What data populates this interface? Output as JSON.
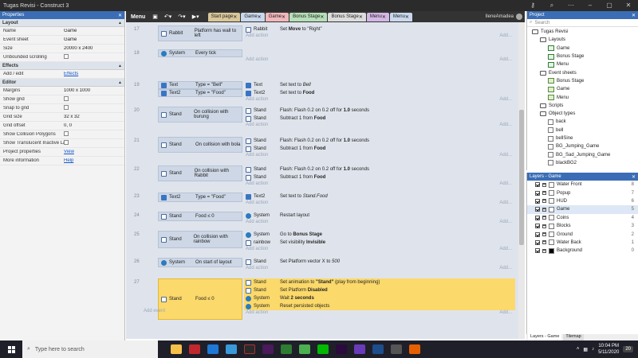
{
  "app": {
    "title": "Tugas Revisi - Construct 3"
  },
  "properties": {
    "header": "Properties",
    "sections": [
      {
        "name": "Layout",
        "rows": [
          {
            "k": "Name",
            "v": "Game"
          },
          {
            "k": "Event sheet",
            "v": "Game"
          },
          {
            "k": "Size",
            "v": "20000 x 2400"
          },
          {
            "k": "Unbounded scrolling",
            "v": ""
          }
        ]
      },
      {
        "name": "Effects",
        "rows": [
          {
            "k": "Add / edit",
            "v": "Effects",
            "link": true
          }
        ]
      },
      {
        "name": "Editor",
        "rows": [
          {
            "k": "Margins",
            "v": "1000 x 1000"
          },
          {
            "k": "Show grid",
            "v": ""
          },
          {
            "k": "Snap to grid",
            "v": ""
          },
          {
            "k": "Grid size",
            "v": "32 x 32"
          },
          {
            "k": "Grid offset",
            "v": "0, 0"
          },
          {
            "k": "Show Collision Polygons",
            "v": ""
          },
          {
            "k": "Show Translucent Inactive Layers",
            "v": ""
          },
          {
            "k": "Project properties",
            "v": "View",
            "link": true
          },
          {
            "k": "More information",
            "v": "Help",
            "link": true
          }
        ]
      }
    ]
  },
  "toolbar": {
    "menu": "Menu",
    "user": "IleneAmadea"
  },
  "tabs": [
    {
      "label": "Start page",
      "color": "#d9c79a"
    },
    {
      "label": "Game",
      "color": "#c9d8ec"
    },
    {
      "label": "Game",
      "color": "#f1b7bd"
    },
    {
      "label": "Bonus Stage",
      "color": "#b6dfb8"
    },
    {
      "label": "Bonus Stage",
      "color": "#dcdcdc"
    },
    {
      "label": "Menu",
      "color": "#d3b7e4"
    },
    {
      "label": "Menu",
      "color": "#c9d8ec"
    }
  ],
  "events": [
    {
      "n": "17",
      "conds": [
        {
          "obj": "Rabbit",
          "text": "Platform has wall to left"
        }
      ],
      "acts": [
        {
          "obj": "Rabbit",
          "text": "Set Move to \"Right\""
        }
      ]
    },
    {
      "n": "18",
      "conds": [
        {
          "obj": "System",
          "text": "Every tick"
        }
      ],
      "acts": []
    },
    {
      "n": "19",
      "conds": [
        {
          "obj": "Text",
          "text": "Type = \"Bell\""
        },
        {
          "obj": "Text2",
          "text": "Type = \"Food\""
        }
      ],
      "acts": [
        {
          "obj": "Text",
          "text": "Set text to Bell"
        },
        {
          "obj": "Text2",
          "text": "Set text to Food"
        }
      ]
    },
    {
      "n": "20",
      "conds": [
        {
          "obj": "Stand",
          "text": "On collision with burung"
        }
      ],
      "acts": [
        {
          "obj": "Stand",
          "text": "Flash: Flash 0.2 on 0.2 off for 1.0 seconds"
        },
        {
          "obj": "Stand",
          "text": "Subtract 1 from Food"
        }
      ]
    },
    {
      "n": "21",
      "conds": [
        {
          "obj": "Stand",
          "text": "On collision with bola"
        }
      ],
      "acts": [
        {
          "obj": "Stand",
          "text": "Flash: Flash 0.2 on 0.2 off for 1.0 seconds"
        },
        {
          "obj": "Stand",
          "text": "Subtract 1 from Food"
        }
      ]
    },
    {
      "n": "22",
      "conds": [
        {
          "obj": "Stand",
          "text": "On collision with Rabbit"
        }
      ],
      "acts": [
        {
          "obj": "Stand",
          "text": "Flash: Flash 0.2 on 0.2 off for 1.0 seconds"
        },
        {
          "obj": "Stand",
          "text": "Subtract 1 from Food"
        }
      ]
    },
    {
      "n": "23",
      "conds": [
        {
          "obj": "Text2",
          "text": "Type = \"Food\""
        }
      ],
      "acts": [
        {
          "obj": "Text2",
          "text": "Set text to Stand.Food"
        }
      ]
    },
    {
      "n": "24",
      "conds": [
        {
          "obj": "Stand",
          "text": "Food ≤ 0"
        }
      ],
      "acts": [
        {
          "obj": "System",
          "text": "Restart layout"
        }
      ]
    },
    {
      "n": "25",
      "conds": [
        {
          "obj": "Stand",
          "text": "On collision with rainbow"
        }
      ],
      "acts": [
        {
          "obj": "System",
          "text": "Go to Bonus Stage"
        },
        {
          "obj": "rainbow",
          "text": "Set visibility Invisible"
        }
      ]
    },
    {
      "n": "26",
      "conds": [
        {
          "obj": "System",
          "text": "On start of layout"
        }
      ],
      "acts": [
        {
          "obj": "Stand",
          "text": "Set Platform vector X to 500"
        }
      ]
    },
    {
      "n": "27",
      "conds": [
        {
          "obj": "Stand",
          "text": "Food ≤ 0"
        }
      ],
      "acts": [
        {
          "obj": "Stand",
          "text": "Set animation to \"Stand\" (play from beginning)"
        },
        {
          "obj": "Stand",
          "text": "Set Platform Disabled"
        },
        {
          "obj": "System",
          "text": "Wait 2 seconds"
        },
        {
          "obj": "System",
          "text": "Reset persisted objects"
        }
      ]
    }
  ],
  "labels": {
    "add_action": "Add action",
    "add_event": "Add event",
    "add_dots": "Add..."
  },
  "project": {
    "header": "Project",
    "search": "Search",
    "tree": [
      {
        "label": "Tugas Revisi",
        "depth": 0,
        "kind": "folder"
      },
      {
        "label": "Layouts",
        "depth": 1,
        "kind": "folder"
      },
      {
        "label": "Game",
        "depth": 2,
        "kind": "layout"
      },
      {
        "label": "Bonus Stage",
        "depth": 2,
        "kind": "layout"
      },
      {
        "label": "Menu",
        "depth": 2,
        "kind": "layout"
      },
      {
        "label": "Event sheets",
        "depth": 1,
        "kind": "folder"
      },
      {
        "label": "Bonus Stage",
        "depth": 2,
        "kind": "sheet"
      },
      {
        "label": "Game",
        "depth": 2,
        "kind": "sheet"
      },
      {
        "label": "Menu",
        "depth": 2,
        "kind": "sheet"
      },
      {
        "label": "Scripts",
        "depth": 1,
        "kind": "folder"
      },
      {
        "label": "Object types",
        "depth": 1,
        "kind": "folder"
      },
      {
        "label": "back",
        "depth": 2,
        "kind": "obj"
      },
      {
        "label": "bell",
        "depth": 2,
        "kind": "obj"
      },
      {
        "label": "bellSine",
        "depth": 2,
        "kind": "obj"
      },
      {
        "label": "BG_Jumping_Game",
        "depth": 2,
        "kind": "obj"
      },
      {
        "label": "BG_Sad_Jumping_Game",
        "depth": 2,
        "kind": "obj"
      },
      {
        "label": "blackBG2",
        "depth": 2,
        "kind": "obj"
      }
    ]
  },
  "layers": {
    "header": "Layers - Game",
    "items": [
      {
        "name": "Water Front",
        "n": "8",
        "color": "#ffffff"
      },
      {
        "name": "Popup",
        "n": "7",
        "color": "#ffffff"
      },
      {
        "name": "HUD",
        "n": "6",
        "color": "#ffffff"
      },
      {
        "name": "Game",
        "n": "5",
        "color": "#ffffff",
        "active": true
      },
      {
        "name": "Coins",
        "n": "4",
        "color": "#ffffff"
      },
      {
        "name": "Blocks",
        "n": "3",
        "color": "#ffffff"
      },
      {
        "name": "Ground",
        "n": "2",
        "color": "#ffffff"
      },
      {
        "name": "Water Back",
        "n": "1",
        "color": "#ffffff"
      },
      {
        "name": "Background",
        "n": "0",
        "color": "#000000"
      }
    ]
  },
  "bottom_tabs": [
    "Layers - Game",
    "Tilemap"
  ],
  "taskbar": {
    "search": "Type here to search",
    "time": "10:04 PM",
    "date": "5/11/2020",
    "badge": "20"
  }
}
